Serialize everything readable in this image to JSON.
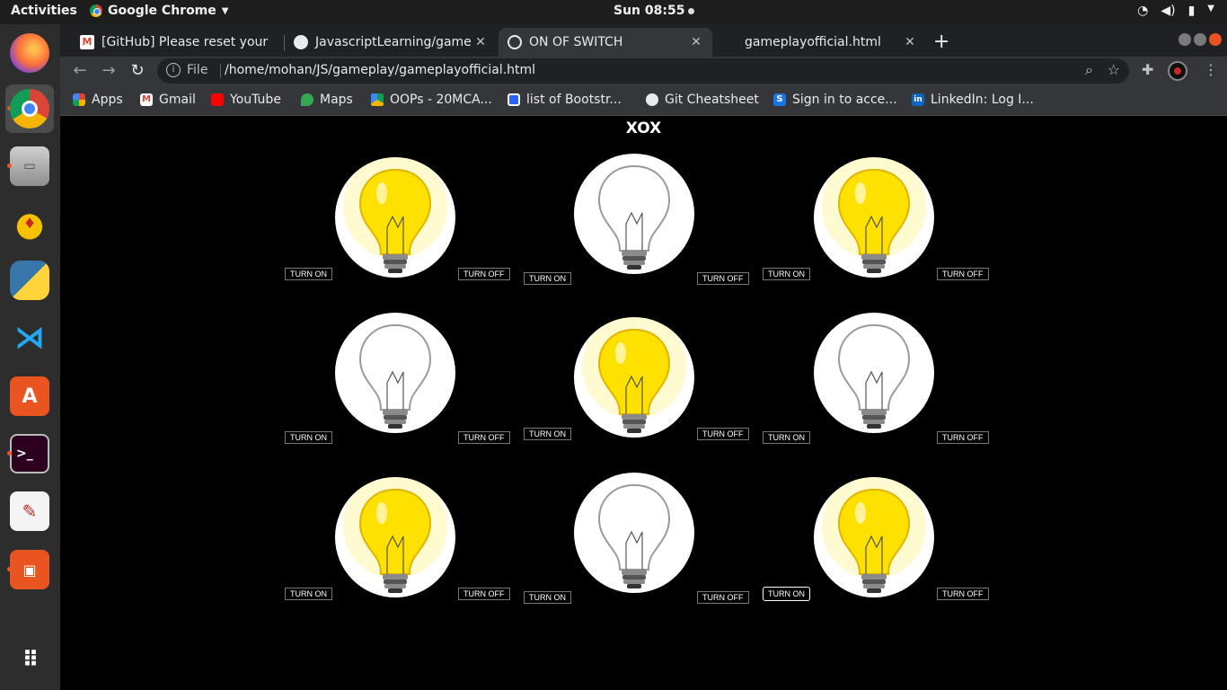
{
  "system": {
    "activities": "Activities",
    "app_name": "Google Chrome",
    "clock": "Sun 08:55"
  },
  "browser": {
    "tabs": [
      {
        "title": "[GitHub] Please reset your",
        "active": false,
        "favicon": "gmail-icon"
      },
      {
        "title": "JavascriptLearning/game",
        "active": false,
        "favicon": "github-icon"
      },
      {
        "title": "ON OF SWITCH",
        "active": true,
        "favicon": "globe-icon"
      },
      {
        "title": "gameplayofficial.html",
        "active": false,
        "favicon": "file-icon"
      }
    ],
    "address": {
      "scheme": "File",
      "url": "/home/mohan/JS/gameplay/gameplayofficial.html"
    },
    "bookmarks": [
      {
        "label": "Apps",
        "icon": "apps-grid-icon"
      },
      {
        "label": "Gmail",
        "icon": "gmail-icon"
      },
      {
        "label": "YouTube",
        "icon": "youtube-icon"
      },
      {
        "label": "Maps",
        "icon": "maps-icon"
      },
      {
        "label": "OOPs - 20MCA...",
        "icon": "drive-icon"
      },
      {
        "label": "list of Bootstr...",
        "icon": "hashnode-icon"
      },
      {
        "label": "Git Cheatsheet",
        "icon": "github-icon"
      },
      {
        "label": "Sign in to acce...",
        "icon": "s-icon"
      },
      {
        "label": "LinkedIn: Log I...",
        "icon": "linkedin-icon"
      }
    ]
  },
  "page": {
    "title": "XOX",
    "turn_on_label": "TURN ON",
    "turn_off_label": "TURN OFF",
    "bulbs": [
      {
        "state": "on"
      },
      {
        "state": "off"
      },
      {
        "state": "on"
      },
      {
        "state": "off"
      },
      {
        "state": "on"
      },
      {
        "state": "off"
      },
      {
        "state": "on"
      },
      {
        "state": "off"
      },
      {
        "state": "on"
      }
    ]
  },
  "colors": {
    "accent": "#e95420",
    "bulb_on": "#ffe100",
    "page_bg": "#000000"
  }
}
